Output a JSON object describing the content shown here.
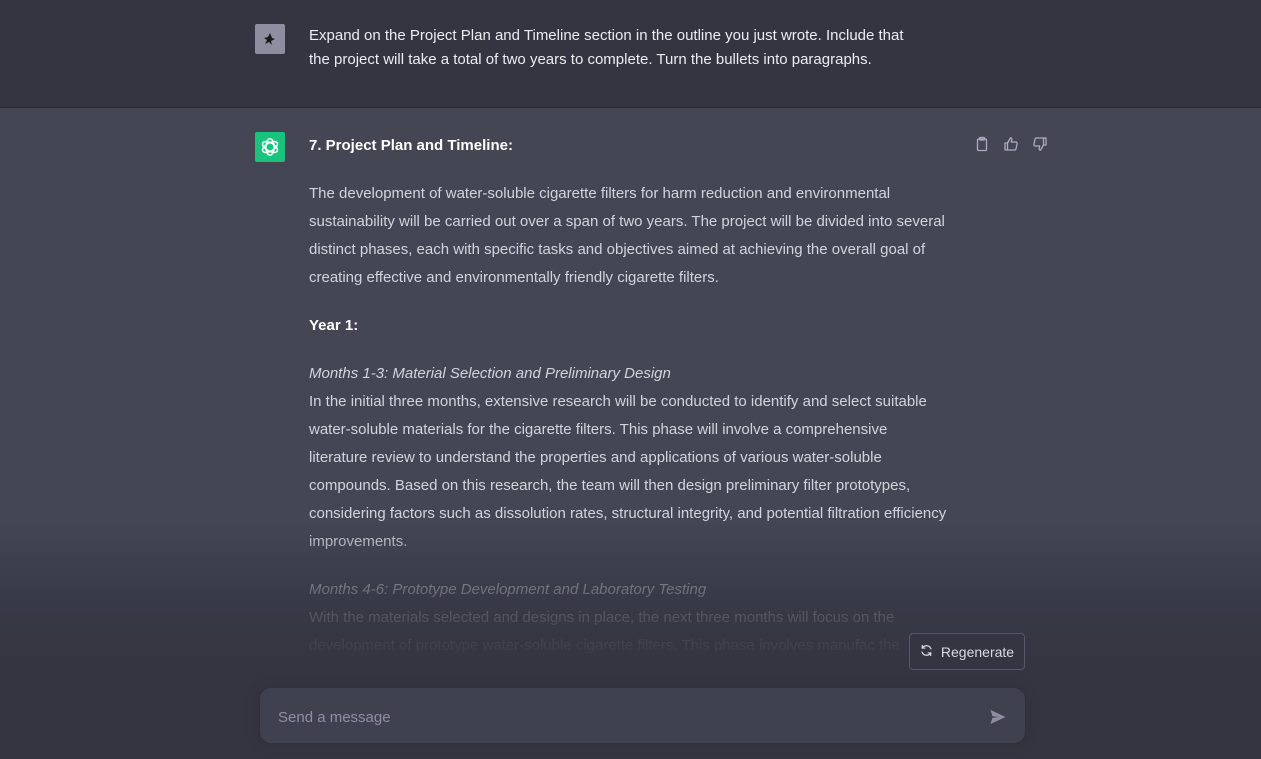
{
  "user_message": {
    "line1": "Expand on the Project Plan and Timeline section in the outline you just wrote. Include that",
    "line2": "the project will take a total of two years to complete. Turn the bullets into paragraphs."
  },
  "assistant_message": {
    "heading": "7. Project Plan and Timeline:",
    "intro": "The development of water-soluble cigarette filters for harm reduction and environmental sustainability will be carried out over a span of two years. The project will be divided into several distinct phases, each with specific tasks and objectives aimed at achieving the overall goal of creating effective and environmentally friendly cigarette filters.",
    "year1": "Year 1:",
    "phase1_title": "Months 1-3: Material Selection and Preliminary Design",
    "phase1_body": "In the initial three months, extensive research will be conducted to identify and select suitable water-soluble materials for the cigarette filters. This phase will involve a comprehensive literature review to understand the properties and applications of various water-soluble compounds. Based on this research, the team will then design preliminary filter prototypes, considering factors such as dissolution rates, structural integrity, and potential filtration efficiency improvements.",
    "phase2_title": "Months 4-6: Prototype Development and Laboratory Testing",
    "phase2_body": "With the materials selected and designs in place, the next three months will focus on the development of prototype water-soluble cigarette filters. This phase involves manufac the prototypes and subjecting them to laboratory testing. Various experiments will be"
  },
  "actions": {
    "copy_icon": "clipboard-icon",
    "like_icon": "thumbs-up-icon",
    "dislike_icon": "thumbs-down-icon"
  },
  "regenerate": {
    "label": "Regenerate",
    "icon": "refresh-icon"
  },
  "composer": {
    "placeholder": "Send a message",
    "send_icon": "paper-plane-icon"
  },
  "colors": {
    "user_bg": "#343541",
    "assistant_bg": "#444654",
    "gpt_logo_bg": "#19c37d"
  }
}
